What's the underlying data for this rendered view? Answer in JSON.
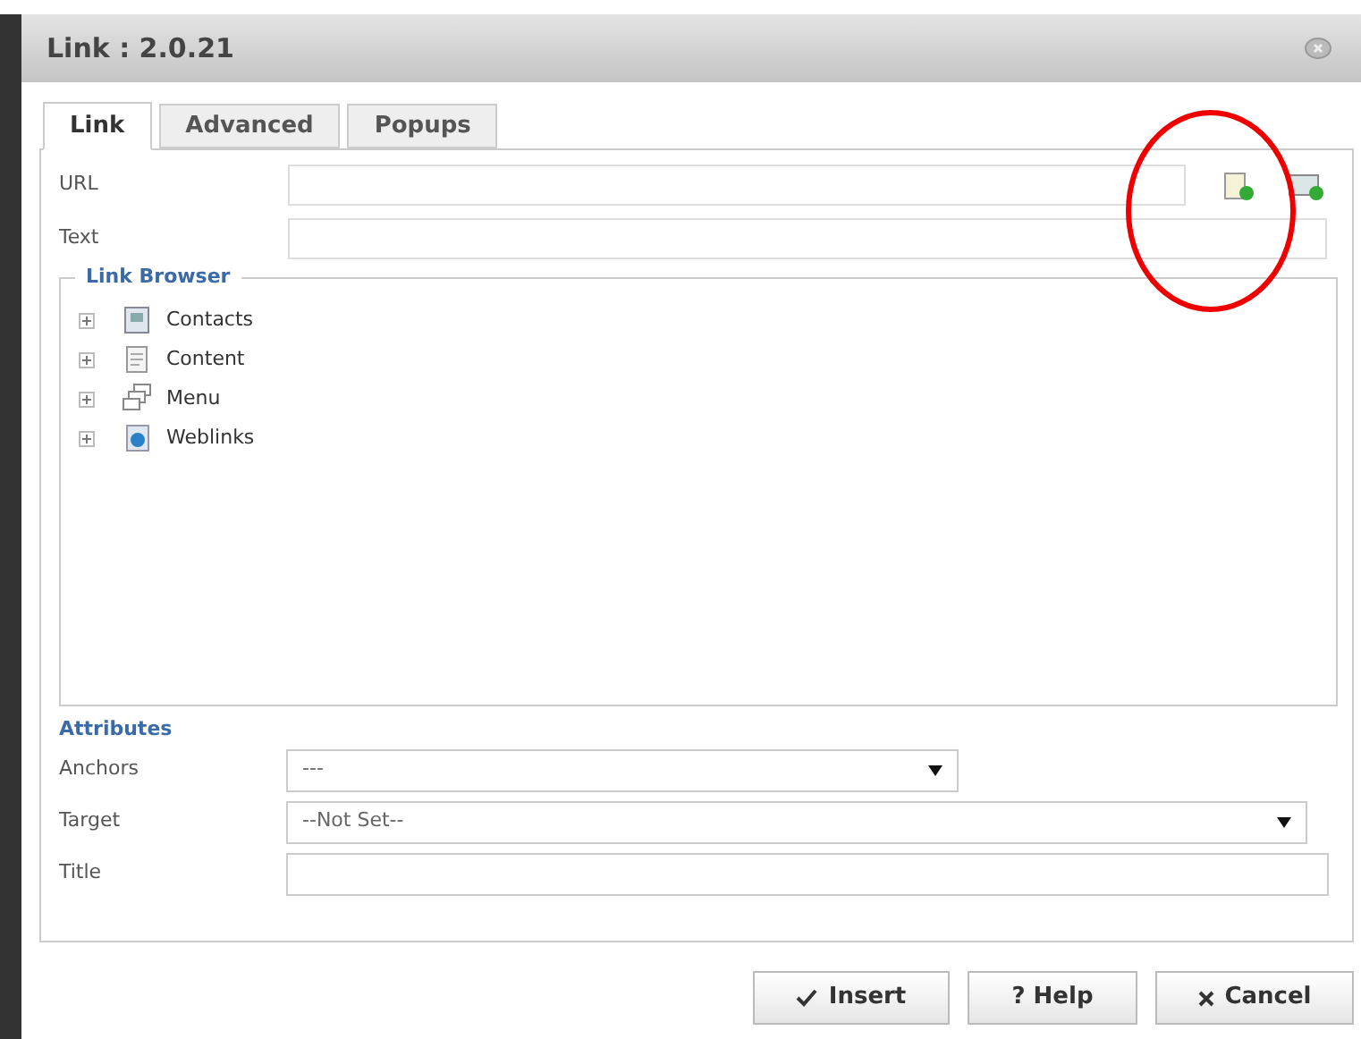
{
  "window": {
    "title": "Link : 2.0.21"
  },
  "tabs": [
    {
      "label": "Link",
      "selected": true
    },
    {
      "label": "Advanced",
      "selected": false
    },
    {
      "label": "Popups",
      "selected": false
    }
  ],
  "url": {
    "label": "URL"
  },
  "text": {
    "label": "Text"
  },
  "link_browser": {
    "title": "Link Browser",
    "items": [
      {
        "label": "Contacts",
        "kind": "contacts",
        "expanded": false
      },
      {
        "label": "Content",
        "kind": "content",
        "expanded": false
      },
      {
        "label": "Menu",
        "kind": "menu",
        "expanded": false
      },
      {
        "label": "Weblinks",
        "kind": "weblinks",
        "expanded": false
      }
    ]
  },
  "attributes": {
    "title": "Attributes",
    "fields": [
      {
        "label": "Anchors",
        "kind": "select",
        "value": "---",
        "wide": false
      },
      {
        "label": "Target",
        "kind": "select",
        "value": "--Not Set--",
        "wide": true
      },
      {
        "label": "Title",
        "kind": "text"
      }
    ]
  },
  "buttons": [
    {
      "label": "Insert",
      "kind": "insert"
    },
    {
      "label": "? Help",
      "kind": "help"
    },
    {
      "label": "Cancel",
      "kind": "cancel"
    }
  ],
  "annotations": [
    {
      "kind": "ellipse",
      "color": "#ee0000"
    }
  ]
}
